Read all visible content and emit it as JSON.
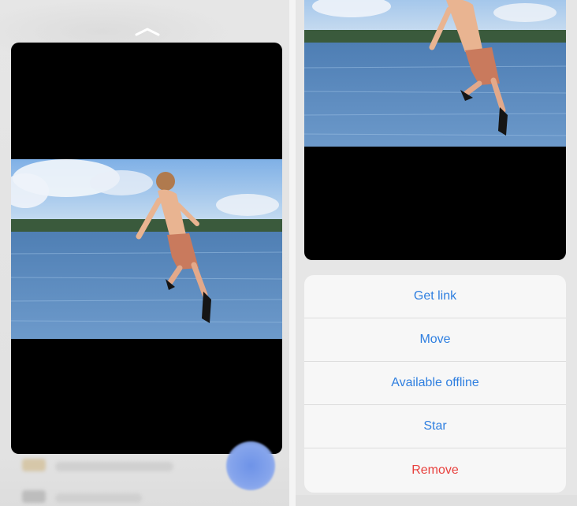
{
  "preview": {
    "image_subject": "boy-jumping-into-lake"
  },
  "action_sheet": {
    "items": [
      {
        "label": "Get link",
        "style": "default"
      },
      {
        "label": "Move",
        "style": "default"
      },
      {
        "label": "Available offline",
        "style": "default"
      },
      {
        "label": "Star",
        "style": "default"
      },
      {
        "label": "Remove",
        "style": "destructive"
      }
    ]
  },
  "colors": {
    "action_blue": "#2f7fe0",
    "destructive_red": "#e8403d",
    "sheet_background": "#f7f7f7",
    "preview_background": "#000000",
    "fab_blue": "#6e93e8"
  }
}
